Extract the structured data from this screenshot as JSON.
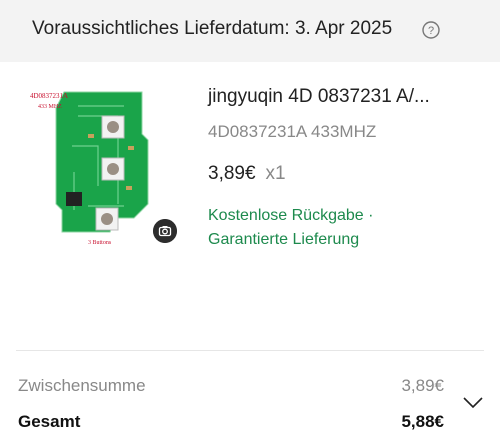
{
  "header": {
    "delivery_text": "Voraussichtliches Lieferdatum: 3. Apr 2025"
  },
  "product": {
    "image_labels": {
      "part_number": "4D0837231A",
      "frequency": "433 MHZ",
      "buttons": "3 Buttons"
    },
    "title": "jingyuqin 4D 0837231 A/...",
    "variant": "4D0837231A 433MHZ",
    "price": "3,89€",
    "quantity": "x1",
    "benefit_line1": "Kostenlose Rückgabe ·",
    "benefit_line2": "Garantierte Lieferung"
  },
  "summary": {
    "subtotal_label": "Zwischensumme",
    "subtotal_value": "3,89€",
    "total_label": "Gesamt",
    "total_value": "5,88€"
  },
  "colors": {
    "accent_green": "#1d8a4d",
    "header_bg": "#f3f3f3",
    "pcb_green": "#1aa44a"
  },
  "icons": {
    "help": "help-circle-icon",
    "camera": "camera-icon",
    "expand": "chevron-down-icon"
  }
}
